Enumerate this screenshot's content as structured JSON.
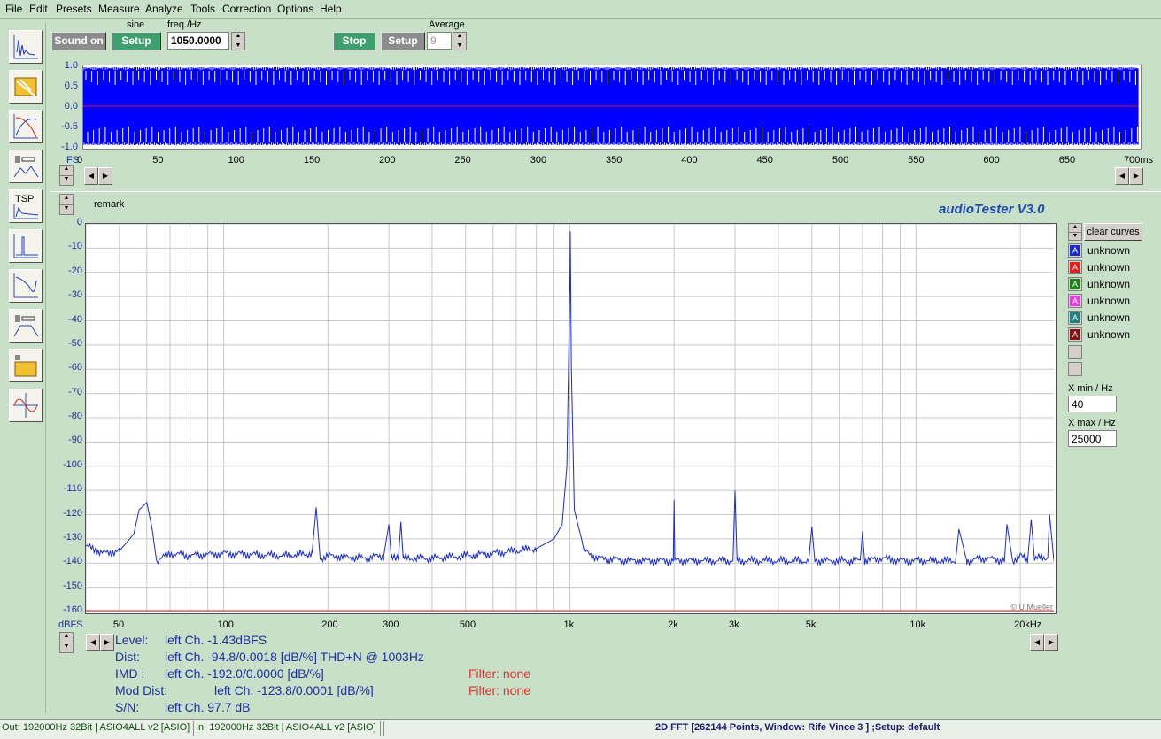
{
  "menu": [
    "File",
    "Edit",
    "Presets",
    "Measure",
    "Analyze",
    "Tools",
    "Correction",
    "Options",
    "Help"
  ],
  "gen": {
    "sound_on": "Sound on",
    "sine_label": "sine",
    "setup": "Setup",
    "freq_label": "freq./Hz",
    "freq_value": "1050.0000",
    "stop": "Stop",
    "setup2": "Setup",
    "average_label": "Average",
    "average_value": "9"
  },
  "scope": {
    "y_ticks": [
      "1.0",
      "0.5",
      "0.0",
      "-0.5",
      "-1.0"
    ],
    "x_ticks": [
      "0",
      "50",
      "100",
      "150",
      "200",
      "250",
      "300",
      "350",
      "400",
      "450",
      "500",
      "550",
      "600",
      "650",
      "700ms"
    ],
    "fs_label": "FS",
    "trace_color": "#0000ff"
  },
  "fft": {
    "remark": "remark",
    "brand": "audioTester  V3.0",
    "copyright": "© U.Mueller",
    "y_unit": "dBFS",
    "clear_curves": "clear curves",
    "x_min_label": "X min / Hz",
    "x_min_value": "40",
    "x_max_label": "X max / Hz",
    "x_max_value": "25000",
    "curves": [
      {
        "label": "unknown",
        "color": "#1a2cc8",
        "letter": "A"
      },
      {
        "label": "unknown",
        "color": "#e02020",
        "letter": "A"
      },
      {
        "label": "unknown",
        "color": "#208020",
        "letter": "A"
      },
      {
        "label": "unknown",
        "color": "#e040e0",
        "letter": "A"
      },
      {
        "label": "unknown",
        "color": "#208080",
        "letter": "A"
      },
      {
        "label": "unknown",
        "color": "#801818",
        "letter": "A"
      }
    ]
  },
  "chart_data": {
    "type": "line",
    "title": "",
    "xlabel": "",
    "ylabel": "dBFS",
    "x_scale": "log",
    "xlim": [
      40,
      25000
    ],
    "ylim": [
      -160,
      0
    ],
    "x_tick_labels": [
      "50",
      "100",
      "200",
      "300",
      "500",
      "1k",
      "2k",
      "3k",
      "5k",
      "10k",
      "20kHz"
    ],
    "y_tick_labels": [
      "0",
      "-10",
      "-20",
      "-30",
      "-40",
      "-50",
      "-60",
      "-70",
      "-80",
      "-90",
      "-100",
      "-110",
      "-120",
      "-130",
      "-140",
      "-150",
      "-160"
    ],
    "grid": true,
    "series": [
      {
        "color": "#1a2cc8",
        "x": [
          40,
          45,
          50,
          55,
          57,
          60,
          62,
          64,
          70,
          80,
          100,
          150,
          180,
          185,
          190,
          200,
          250,
          290,
          300,
          305,
          320,
          325,
          330,
          400,
          500,
          600,
          800,
          900,
          950,
          980,
          1000,
          1003,
          1010,
          1030,
          1080,
          1100,
          1200,
          1500,
          1990,
          2000,
          2010,
          2500,
          2960,
          3000,
          3040,
          4000,
          4900,
          5000,
          5100,
          6000,
          6900,
          7000,
          7100,
          8000,
          9000,
          10000,
          12000,
          13000,
          13300,
          14000,
          16000,
          18000,
          18300,
          19000,
          20000,
          21000,
          21500,
          22000,
          23000,
          24000,
          24300,
          25000
        ],
        "y": [
          -133,
          -136,
          -135,
          -128,
          -118,
          -115,
          -125,
          -139,
          -136,
          -137,
          -136,
          -137,
          -136,
          -117,
          -138,
          -137,
          -138,
          -137,
          -124,
          -138,
          -137,
          -123,
          -138,
          -138,
          -137,
          -136,
          -134,
          -130,
          -124,
          -100,
          -25,
          -3,
          -60,
          -118,
          -130,
          -135,
          -138,
          -139,
          -139,
          -114,
          -139,
          -139,
          -139,
          -110,
          -139,
          -139,
          -139,
          -125,
          -139,
          -139,
          -139,
          -127,
          -139,
          -138,
          -139,
          -139,
          -139,
          -139,
          -126,
          -139,
          -138,
          -139,
          -124,
          -139,
          -137,
          -139,
          -122,
          -139,
          -137,
          -138,
          -120,
          -139
        ]
      }
    ]
  },
  "readout": {
    "level_key": "Level:",
    "level_val": "left Ch. -1.43dBFS",
    "dist_key": "Dist:",
    "dist_val": "left Ch. -94.8/0.0018 [dB/%] THD+N  @ 1003Hz",
    "imd_key": "IMD  :",
    "imd_val": "left Ch. -192.0/0.0000 [dB/%]",
    "imd_filter": "Filter: none",
    "mod_key": "Mod Dist:",
    "mod_val": "left Ch. -123.8/0.0001 [dB/%]",
    "mod_filter": "Filter: none",
    "sn_key": "S/N:",
    "sn_val": "left Ch. 97.7 dB"
  },
  "status": {
    "out": "Out: 192000Hz 32Bit  | ASIO4ALL v2 [ASIO]",
    "in": "In: 192000Hz 32Bit  | ASIO4ALL v2 [ASIO]",
    "info": "2D FFT [262144 Points, Window: Rife Vince 3 ] ;Setup:  default"
  },
  "tools": [
    "oscilloscope-icon",
    "open-file-icon",
    "curves-icon",
    "frequency-response-icon",
    "tsp-icon",
    "spectrum-icon",
    "low-pass-icon",
    "band-response-icon",
    "open-preset-icon",
    "sine-wave-icon"
  ]
}
